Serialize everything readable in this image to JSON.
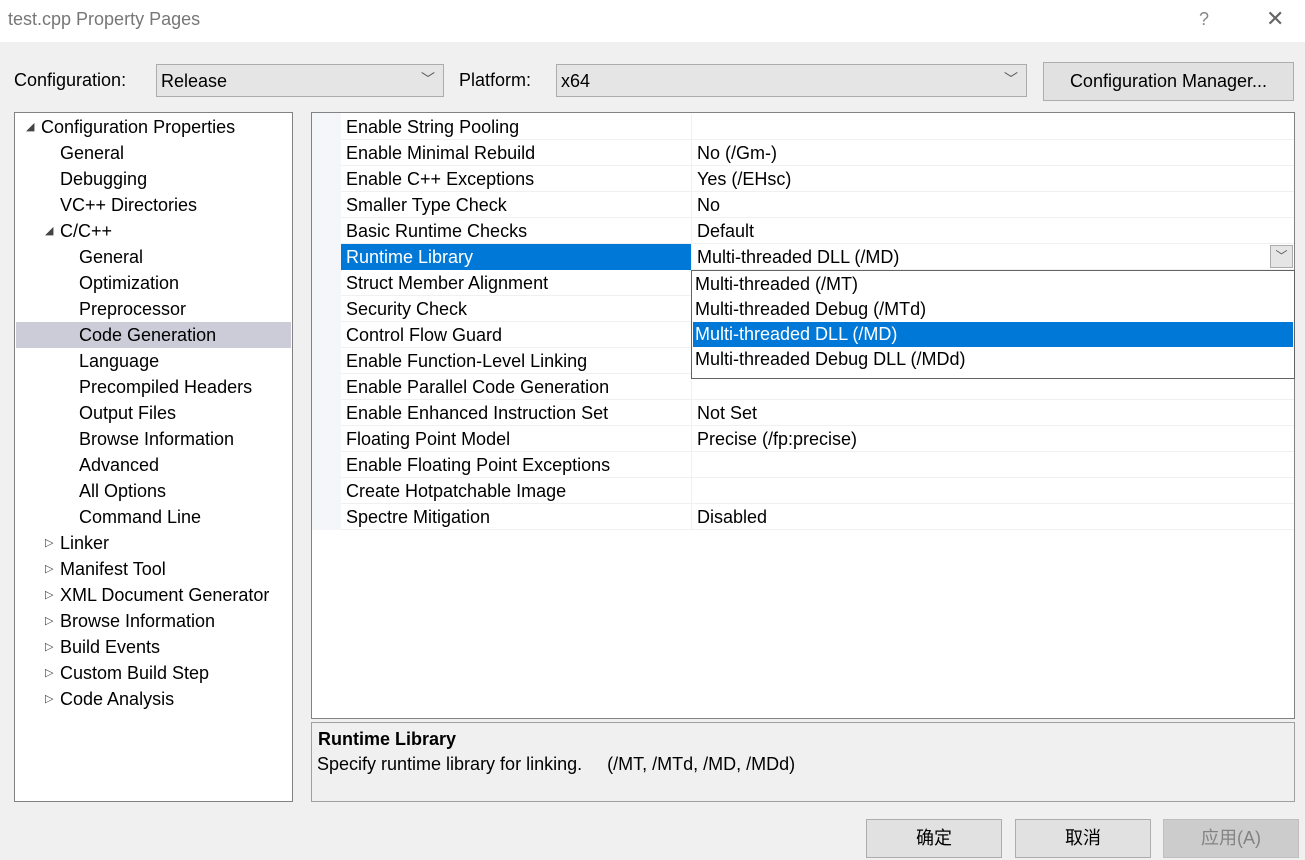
{
  "window": {
    "title": "test.cpp Property Pages",
    "help": "?",
    "close": "✕"
  },
  "toolbar": {
    "configuration_label": "Configuration:",
    "configuration_value": "Release",
    "platform_label": "Platform:",
    "platform_value": "x64",
    "config_manager": "Configuration Manager..."
  },
  "tree": [
    {
      "label": "Configuration Properties",
      "level": 0,
      "arrow": "◢"
    },
    {
      "label": "General",
      "level": 1
    },
    {
      "label": "Debugging",
      "level": 1
    },
    {
      "label": "VC++ Directories",
      "level": 1
    },
    {
      "label": "C/C++",
      "level": 1,
      "arrow": "◢"
    },
    {
      "label": "General",
      "level": 2
    },
    {
      "label": "Optimization",
      "level": 2
    },
    {
      "label": "Preprocessor",
      "level": 2
    },
    {
      "label": "Code Generation",
      "level": 2,
      "selected": true
    },
    {
      "label": "Language",
      "level": 2
    },
    {
      "label": "Precompiled Headers",
      "level": 2
    },
    {
      "label": "Output Files",
      "level": 2
    },
    {
      "label": "Browse Information",
      "level": 2
    },
    {
      "label": "Advanced",
      "level": 2
    },
    {
      "label": "All Options",
      "level": 2
    },
    {
      "label": "Command Line",
      "level": 2
    },
    {
      "label": "Linker",
      "level": 1,
      "arrow": "▷"
    },
    {
      "label": "Manifest Tool",
      "level": 1,
      "arrow": "▷"
    },
    {
      "label": "XML Document Generator",
      "level": 1,
      "arrow": "▷"
    },
    {
      "label": "Browse Information",
      "level": 1,
      "arrow": "▷"
    },
    {
      "label": "Build Events",
      "level": 1,
      "arrow": "▷"
    },
    {
      "label": "Custom Build Step",
      "level": 1,
      "arrow": "▷"
    },
    {
      "label": "Code Analysis",
      "level": 1,
      "arrow": "▷"
    }
  ],
  "properties": [
    {
      "name": "Enable String Pooling",
      "value": ""
    },
    {
      "name": "Enable Minimal Rebuild",
      "value": "No (/Gm-)"
    },
    {
      "name": "Enable C++ Exceptions",
      "value": "Yes (/EHsc)"
    },
    {
      "name": "Smaller Type Check",
      "value": "No"
    },
    {
      "name": "Basic Runtime Checks",
      "value": "Default"
    },
    {
      "name": "Runtime Library",
      "value": "Multi-threaded DLL (/MD)",
      "selected": true
    },
    {
      "name": "Struct Member Alignment",
      "value": ""
    },
    {
      "name": "Security Check",
      "value": ""
    },
    {
      "name": "Control Flow Guard",
      "value": ""
    },
    {
      "name": "Enable Function-Level Linking",
      "value": ""
    },
    {
      "name": "Enable Parallel Code Generation",
      "value": ""
    },
    {
      "name": "Enable Enhanced Instruction Set",
      "value": "Not Set"
    },
    {
      "name": "Floating Point Model",
      "value": "Precise (/fp:precise)"
    },
    {
      "name": "Enable Floating Point Exceptions",
      "value": ""
    },
    {
      "name": "Create Hotpatchable Image",
      "value": ""
    },
    {
      "name": "Spectre Mitigation",
      "value": "Disabled"
    }
  ],
  "dropdown": {
    "options": [
      "Multi-threaded (/MT)",
      "Multi-threaded Debug (/MTd)",
      "Multi-threaded DLL (/MD)",
      "Multi-threaded Debug DLL (/MDd)"
    ],
    "selected_index": 2
  },
  "description": {
    "title": "Runtime Library",
    "text": "Specify runtime library for linking.     (/MT, /MTd, /MD, /MDd)"
  },
  "buttons": {
    "ok": "确定",
    "cancel": "取消",
    "apply": "应用(A)"
  },
  "colors": {
    "accent": "#0078d7",
    "tree_selection": "#ccccd9"
  }
}
